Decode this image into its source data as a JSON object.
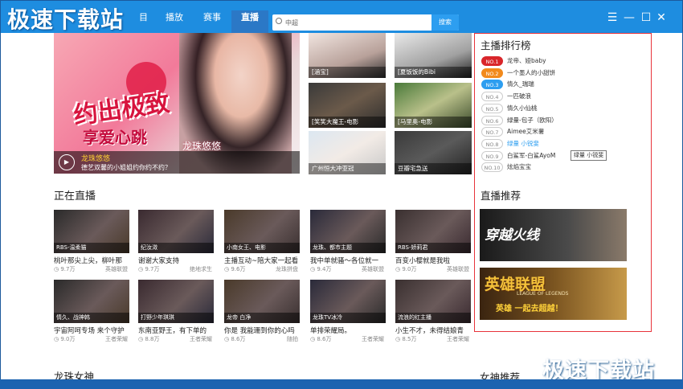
{
  "app": {
    "logo_text": "极速下载站",
    "watermark": "极速下载站"
  },
  "nav": {
    "items": [
      "播放",
      "赛事",
      "直播"
    ],
    "partial_item": "目",
    "active": "直播"
  },
  "search": {
    "value": "中超",
    "button": "搜索"
  },
  "window_controls": {
    "menu": "☰",
    "minimize": "—",
    "maximize": "☐",
    "close": "✕"
  },
  "banner": {
    "headline": "约出极致",
    "subline": "享爱心跳",
    "script": "龙珠悠悠",
    "caption_title": "龙珠悠悠",
    "caption_desc": "德艺双馨的小姐姐约你约不约？"
  },
  "top_thumbs": [
    {
      "label": "[涵宝]"
    },
    {
      "label": "[夏饭饭的Bibi"
    },
    {
      "label": "[笑笑大魔王-电影"
    },
    {
      "label": "[马里奥-电影"
    },
    {
      "label": "广州恒大冲亚冠"
    },
    {
      "label": "豆瓣宅急送"
    }
  ],
  "live": {
    "title": "正在直播",
    "cards": [
      {
        "tag": "RBS-温柔猫",
        "title": "桃叶那尖上尖，柳叶那",
        "views": "9.7万",
        "game": "英雄联盟"
      },
      {
        "tag": "纪汝溦",
        "title": "谢谢大家支持",
        "views": "9.7万",
        "game": "绝地求生"
      },
      {
        "tag": "小南女王、电影",
        "title": "主播互动~陪大家一起看",
        "views": "9.6万",
        "game": "龙珠拼盘"
      },
      {
        "tag": "龙珠、都市主题",
        "title": "我中单就骚～各位就一",
        "views": "9.4万",
        "game": "英雄联盟"
      },
      {
        "tag": "RBS-娇莉君",
        "title": "百变小樱就是我啦",
        "views": "9.0万",
        "game": "英雄联盟"
      },
      {
        "tag": "情久、战神韩",
        "title": "宇宙阿呵专场 来个守护",
        "views": "9.0万",
        "game": "王者荣耀"
      },
      {
        "tag": "打野少年琪琪",
        "title": "东南亚野王，有下单的",
        "views": "8.8万",
        "game": "王者荣耀"
      },
      {
        "tag": "龙帝 白净",
        "title": "你是 我能珊到你的心吗",
        "views": "8.6万",
        "game": "随拍"
      },
      {
        "tag": "龙珠TV冰冷",
        "title": "单排荣耀局。",
        "views": "8.6万",
        "game": "王者荣耀"
      },
      {
        "tag": "流浪的红主播",
        "title": "小生不才，未得结娘青",
        "views": "8.5万",
        "game": "王者荣耀"
      }
    ]
  },
  "ranking": {
    "title": "主播排行榜",
    "items": [
      {
        "no": "NO.1",
        "name": "龙帝、娅baby",
        "color": "#d9262b"
      },
      {
        "no": "NO.2",
        "name": "一个墨人的小甜饼",
        "color": "#f28a1c"
      },
      {
        "no": "NO.3",
        "name": "情久_瑞瑞",
        "color": "#2d9ef0"
      },
      {
        "no": "NO.4",
        "name": "一匹破浪"
      },
      {
        "no": "NO.5",
        "name": "情久小仙桃"
      },
      {
        "no": "NO.6",
        "name": "绿量-包子（欧阳）"
      },
      {
        "no": "NO.7",
        "name": "Aimee艾米薯"
      },
      {
        "no": "NO.8",
        "name": "绿量 小锐斐",
        "highlight": true
      },
      {
        "no": "NO.9",
        "name": "白鲨军-白鲨AyoM"
      },
      {
        "no": "NO.10",
        "name": "炫焰宝宝"
      }
    ],
    "tooltip": "绿量 小锐斐"
  },
  "recommend": {
    "title": "直播推荐",
    "items": [
      {
        "label": "穿越火线"
      },
      {
        "label": "英雄联盟",
        "sub": "英雄 一起去超越！",
        "en": "LEAGUE OF LEGENDS"
      }
    ]
  },
  "footer": {
    "left_title": "龙珠女神",
    "right_title": "女神推荐"
  }
}
